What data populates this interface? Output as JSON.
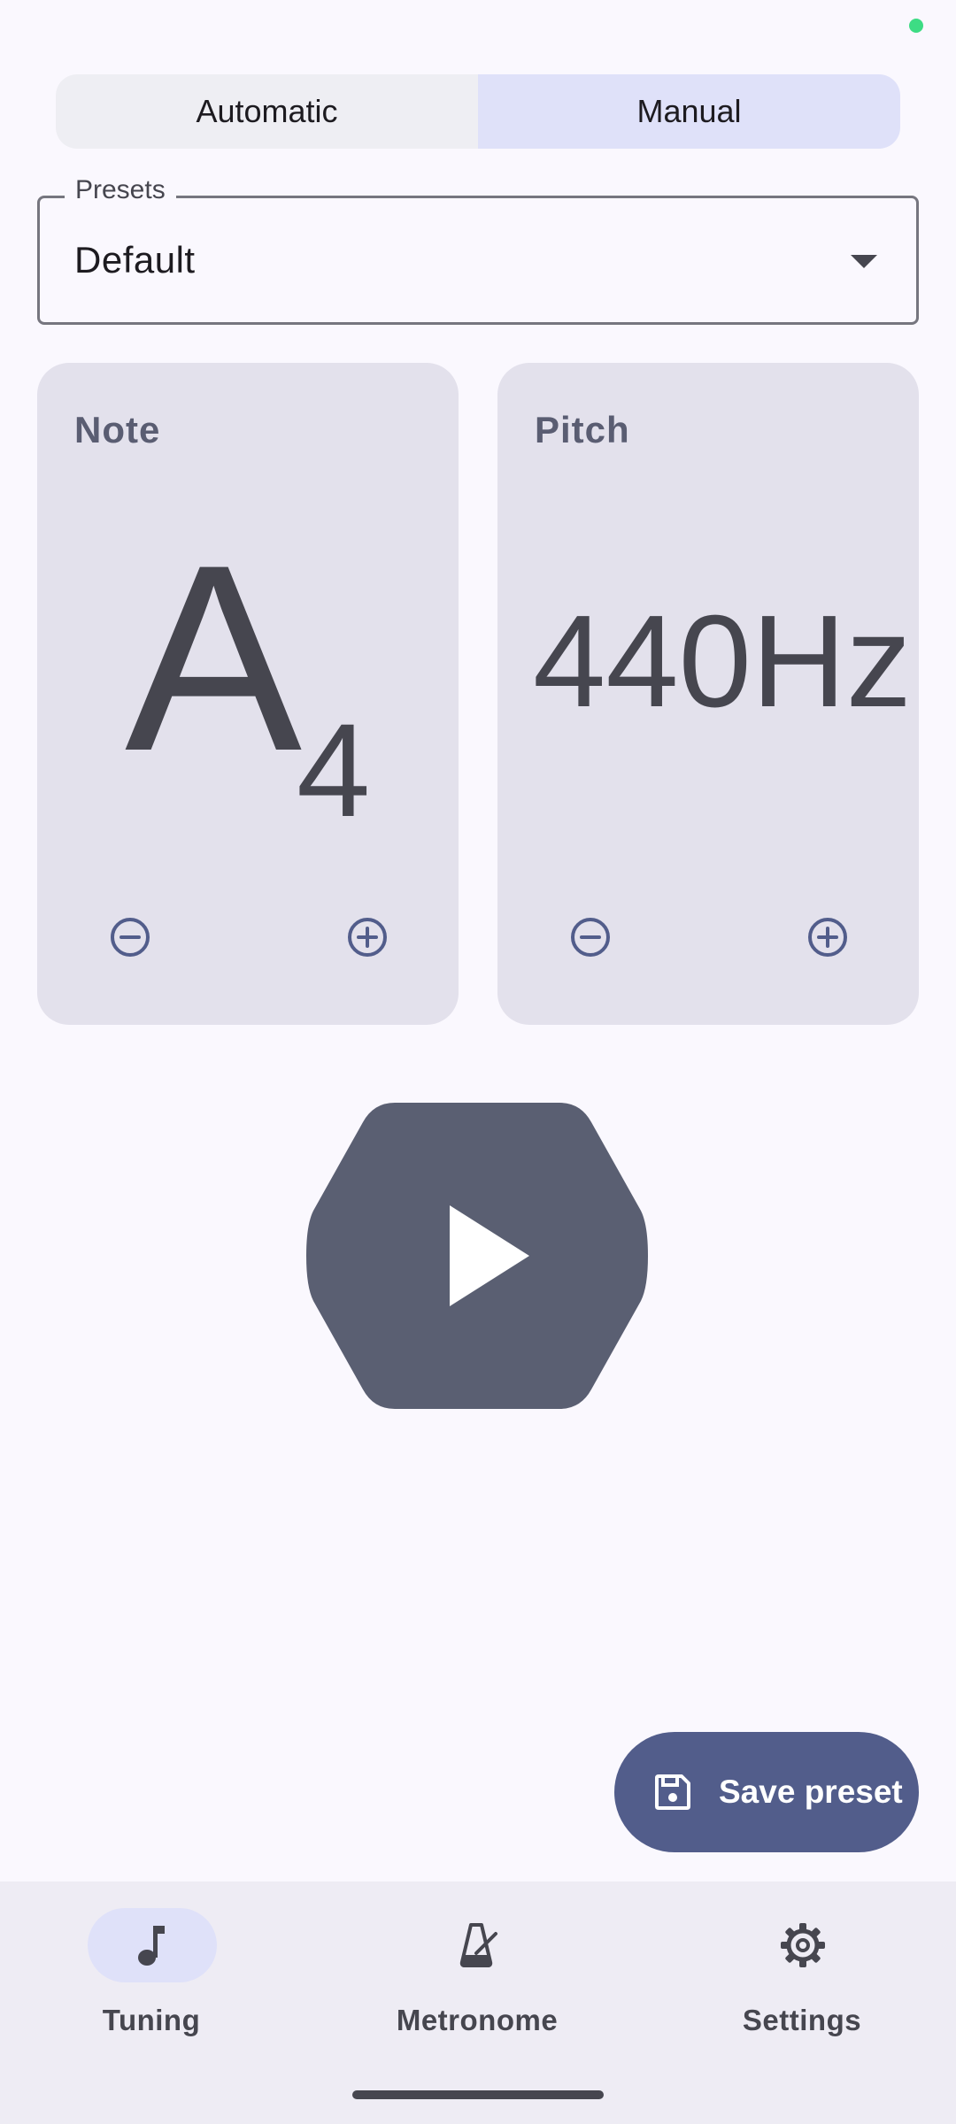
{
  "mode_tabs": [
    {
      "label": "Automatic",
      "selected": false
    },
    {
      "label": "Manual",
      "selected": true
    }
  ],
  "presets": {
    "label": "Presets",
    "value": "Default"
  },
  "note_card": {
    "title": "Note",
    "letter": "A",
    "octave": "4"
  },
  "pitch_card": {
    "title": "Pitch",
    "value": "440Hz"
  },
  "fab": {
    "label": "Save preset",
    "icon": "save-icon"
  },
  "bottom_nav": [
    {
      "label": "Tuning",
      "icon": "music-note-icon",
      "active": true
    },
    {
      "label": "Metronome",
      "icon": "metronome-icon",
      "active": false
    },
    {
      "label": "Settings",
      "icon": "gear-icon",
      "active": false
    }
  ],
  "colors": {
    "background": "#faf8fe",
    "card": "#e3e1ec",
    "accent": "#525d8b",
    "play_button": "#5a5f72",
    "tab_selected": "#dfe1f9",
    "status_dot": "#3ddc84"
  }
}
